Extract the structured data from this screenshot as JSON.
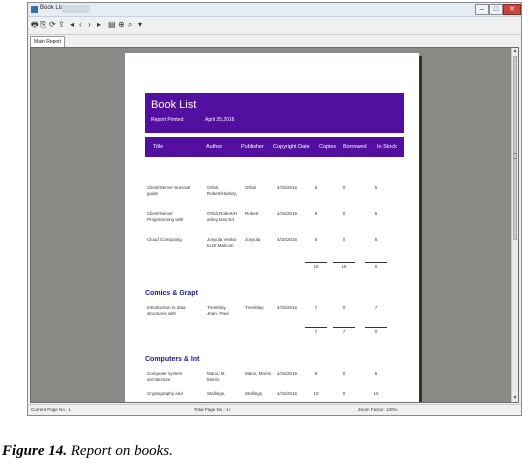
{
  "window": {
    "title": "Book List"
  },
  "toolbar": {
    "icons": [
      "print-icon",
      "copy-icon",
      "refresh-icon",
      "export-icon",
      "first-page-icon",
      "prev-page-icon",
      "next-page-icon",
      "last-page-icon",
      "page-setup-icon",
      "zoom-icon",
      "find-icon",
      "options-icon"
    ]
  },
  "tabs": [
    {
      "label": "Main Report"
    }
  ],
  "report": {
    "title": "Book List",
    "printed_label": "Report Printed:",
    "printed_date": "April 25,2016",
    "columns": [
      "Title",
      "Author",
      "Publisher",
      "Copyright Date",
      "Copies",
      "Borrowed",
      "In Stock"
    ],
    "group1_rows": [
      {
        "title1": "Client/Server Survival",
        "title2": "guide",
        "author1": "Orfali,",
        "author2": "Robert/Harkey,",
        "publisher": "Orfali",
        "date": "4/15/2016",
        "copies": "5",
        "borrowed": "0",
        "stock": "5"
      },
      {
        "title1": "Client/Server",
        "title2": "Programming with",
        "author1": "Orfali,Robert/H",
        "author2": "arkey,Dan,Ed",
        "publisher": "Robert",
        "date": "4/15/2016",
        "copies": "5",
        "borrowed": "0",
        "stock": "5"
      },
      {
        "title1": "Cloud Computing",
        "title2": "",
        "author1": "Josyula Venka",
        "author2": "ta Dr.Malcom",
        "publisher": "Josyula",
        "date": "4/15/2016",
        "copies": "5",
        "borrowed": "0",
        "stock": "5"
      }
    ],
    "group1_totals": [
      "15",
      "15",
      "0"
    ],
    "group2_name": "Comics & Grapt",
    "group2_rows": [
      {
        "title1": "Introduction to data",
        "title2": "structures with",
        "author1": "Tremblay,",
        "author2": "Jean- Paul",
        "publisher": "Tremblay",
        "date": "4/15/2016",
        "copies": "7",
        "borrowed": "0",
        "stock": "7"
      }
    ],
    "group2_totals": [
      "7",
      "7",
      "0"
    ],
    "group3_name": "Computers & Int",
    "group3_rows": [
      {
        "title1": "Computer system",
        "title2": "architecture",
        "author1": "Mano, M",
        "author2": "Morris",
        "publisher": "Mano, Morris",
        "date": "4/15/2016",
        "copies": "6",
        "borrowed": "0",
        "stock": "6"
      },
      {
        "title1": "Cryptography and",
        "title2": "",
        "author1": "Stallings,",
        "author2": "",
        "publisher": "Stallings,",
        "date": "4/15/2016",
        "copies": "10",
        "borrowed": "0",
        "stock": "10"
      }
    ]
  },
  "status": {
    "current_page": "Current Page No.: 1",
    "total_page": "Total Page No.: 1+",
    "zoom": "Zoom Factor: 100%"
  },
  "caption": {
    "label": "Figure 14.",
    "text": " Report on books."
  },
  "colors": {
    "banner": "#520fa0",
    "group_heading": "#1a1a8c",
    "canvas": "#8c8a87"
  }
}
